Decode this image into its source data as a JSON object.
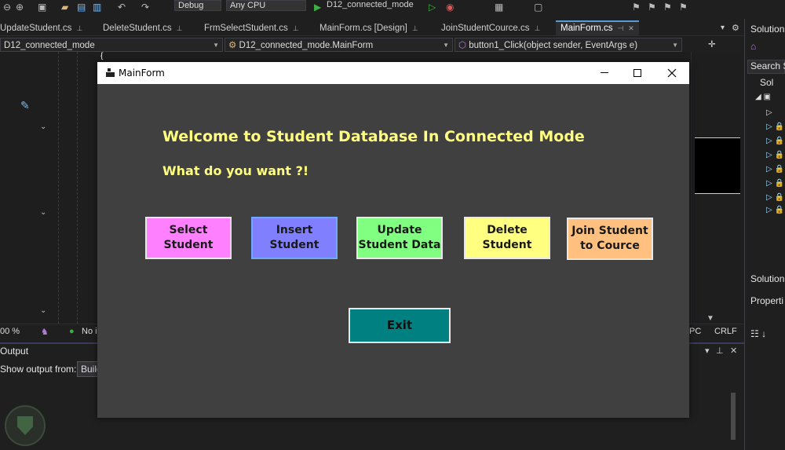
{
  "ide": {
    "toolbar": {
      "configuration": "Debug",
      "platform": "Any CPU",
      "startup_project": "D12_connected_mode"
    },
    "tabs": [
      {
        "label": "UpdateStudent.cs"
      },
      {
        "label": "DeleteStudent.cs"
      },
      {
        "label": "FrmSelectStudent.cs"
      },
      {
        "label": "MainForm.cs [Design]"
      },
      {
        "label": "JoinStudentCource.cs"
      },
      {
        "label": "MainForm.cs",
        "active": true
      }
    ],
    "navigation": {
      "project": "D12_connected_mode",
      "class": "D12_connected_mode.MainForm",
      "member": "button1_Click(object sender, EventArgs e)"
    },
    "status": {
      "zoom": "00 %",
      "issues": "No i",
      "encoding": "PC",
      "line_ending": "CRLF"
    },
    "output": {
      "title": "Output",
      "show_output_from": "Show output from:",
      "source": "Build"
    },
    "solution_panel": {
      "title": "Solution",
      "search": "Search S",
      "root": "Sol",
      "footer": "Solution",
      "properties": "Properti"
    }
  },
  "form": {
    "title": "MainForm",
    "welcome_text": "Welcome to Student Database In Connected Mode",
    "question_text": "What do you want ?!",
    "buttons": {
      "select": "Select\nStudent",
      "insert": "Insert\nStudent",
      "update": "Update\nStudent Data",
      "delete": "Delete\nStudent",
      "join": "Join Student\nto Cource",
      "exit": "Exit"
    },
    "colors": {
      "background": "#404040",
      "heading": "#ffff80",
      "select": "#ff80ff",
      "insert": "#8080ff",
      "update": "#80ff80",
      "delete": "#ffff80",
      "join": "#ffc080",
      "exit": "#008080"
    }
  }
}
